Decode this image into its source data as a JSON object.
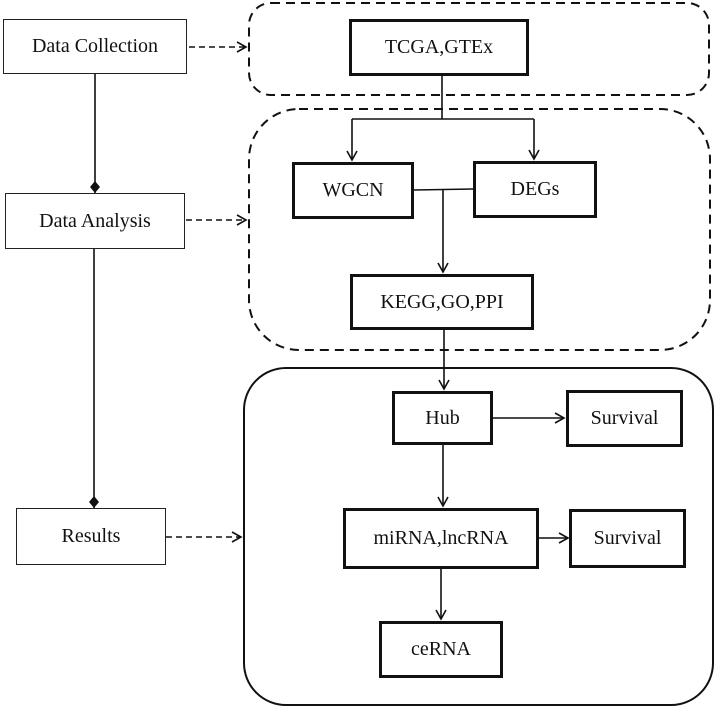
{
  "stages": {
    "collection": "Data Collection",
    "analysis": "Data Analysis",
    "results": "Results"
  },
  "nodes": {
    "tcga": "TCGA,GTEx",
    "wgcn": "WGCN",
    "degs": "DEGs",
    "kegg": "KEGG,GO,PPI",
    "hub": "Hub",
    "survival1": "Survival",
    "mirna": "miRNA,lncRNA",
    "survival2": "Survival",
    "cerna": "ceRNA"
  }
}
